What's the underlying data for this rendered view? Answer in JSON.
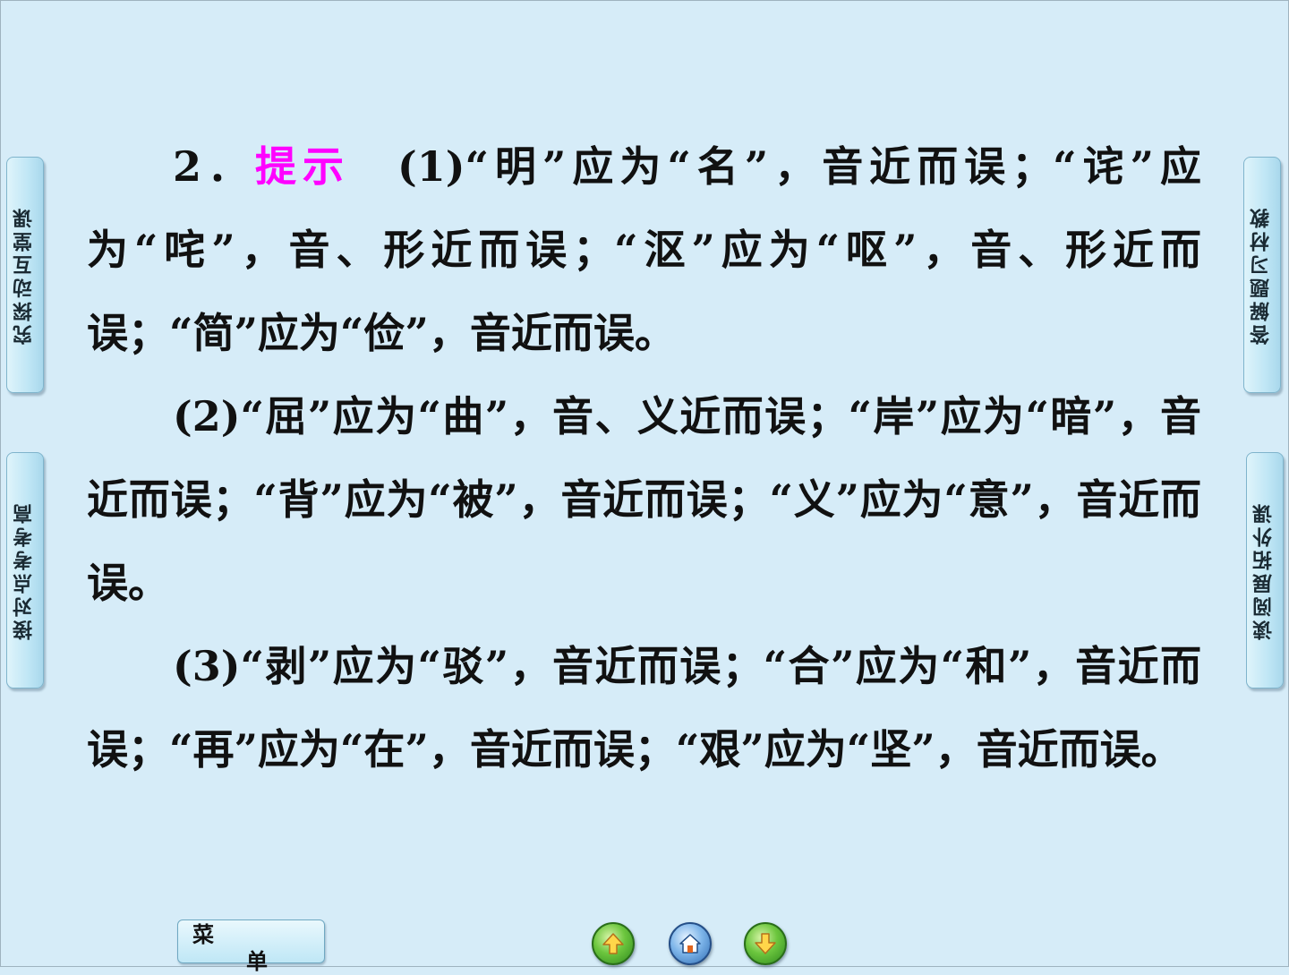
{
  "side_tabs": {
    "left_top": "究探动互堂课",
    "left_bottom": "接对点考考高",
    "right_top": "答解题习材教",
    "right_bottom": "读阅展拓外课"
  },
  "content": {
    "number": "2．",
    "hint_label": "提示",
    "p1": "　(1)“明”应为“名”，音近而误；“诧”应为“咤”，音、形近而误；“沤”应为“呕”，音、形近而误；“简”应为“俭”，音近而误。",
    "p2": "(2)“屈”应为“曲”，音、义近而误；“岸”应为“暗”，音近而误；“背”应为“被”，音近而误；“义”应为“意”，音近而误。",
    "p3": "(3)“剥”应为“驳”，音近而误；“合”应为“和”，音近而误；“再”应为“在”，音近而误；“艰”应为“坚”，音近而误。"
  },
  "menu": {
    "char1": "菜",
    "char2": "单"
  },
  "nav": {
    "prev_icon": "up-arrow-icon",
    "home_icon": "home-icon",
    "next_icon": "down-arrow-icon"
  },
  "colors": {
    "background": "#d6ecf8",
    "hint": "#ff00ff",
    "text": "#111111"
  }
}
